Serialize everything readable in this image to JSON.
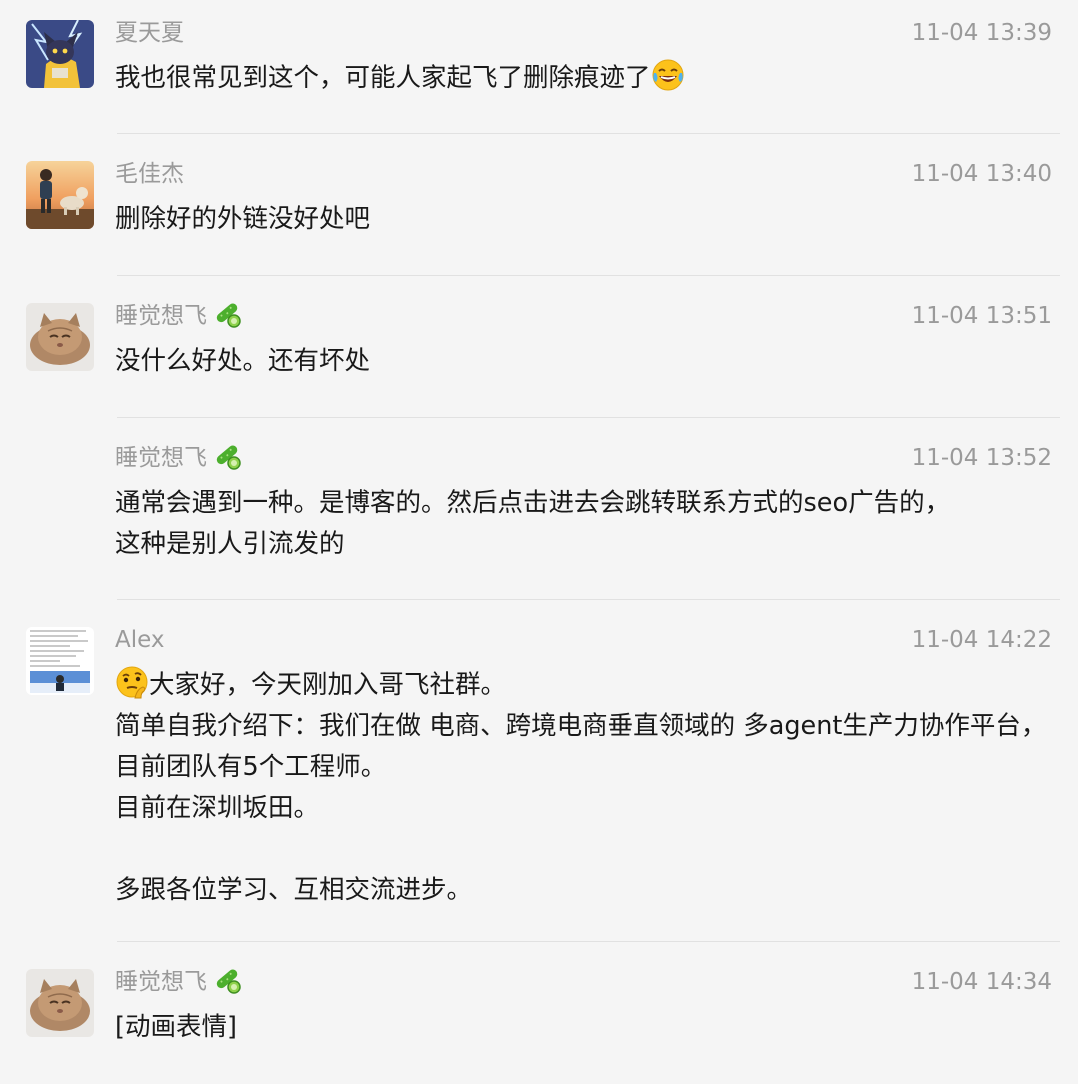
{
  "messages": [
    {
      "sender": "夏天夏",
      "time": "11-04 13:39",
      "text": "我也很常见到这个，可能人家起飞了删除痕迹了",
      "avatar_icon": "cartoon-cat-avatar-icon",
      "inline_emoji": "tears-of-joy-emoji"
    },
    {
      "sender": "毛佳杰",
      "time": "11-04 13:40",
      "text": "删除好的外链没好处吧",
      "avatar_icon": "sunset-boy-dog-avatar-icon"
    },
    {
      "sender": "睡觉想飞",
      "time": "11-04 13:51",
      "text": "没什么好处。还有坏处",
      "avatar_icon": "sleepy-cat-avatar-icon",
      "badge_icon": "cucumber-badge-icon"
    },
    {
      "sender": "睡觉想飞",
      "time": "11-04 13:52",
      "text": "通常会遇到一种。是博客的。然后点击进去会跳转联系方式的seo广告的，\n这种是别人引流发的",
      "badge_icon": "cucumber-badge-icon"
    },
    {
      "sender": "Alex",
      "time": "11-04 14:22",
      "text": "大家好，今天刚加入哥飞社群。\n简单自我介绍下：我们在做 电商、跨境电商垂直领域的 多agent生产力协作平台，目前团队有5个工程师。\n目前在深圳坂田。\n\n多跟各位学习、互相交流进步。",
      "avatar_icon": "document-photo-avatar-icon",
      "inline_emoji": "thinking-face-emoji"
    },
    {
      "sender": "睡觉想飞",
      "time": "11-04 14:34",
      "text": "[动画表情]",
      "avatar_icon": "sleepy-cat-avatar-icon",
      "badge_icon": "cucumber-badge-icon"
    }
  ],
  "colors": {
    "background": "#f5f5f5",
    "meta_text": "#9a9a9a",
    "message_text": "#191919",
    "divider": "#e1e1e1"
  }
}
